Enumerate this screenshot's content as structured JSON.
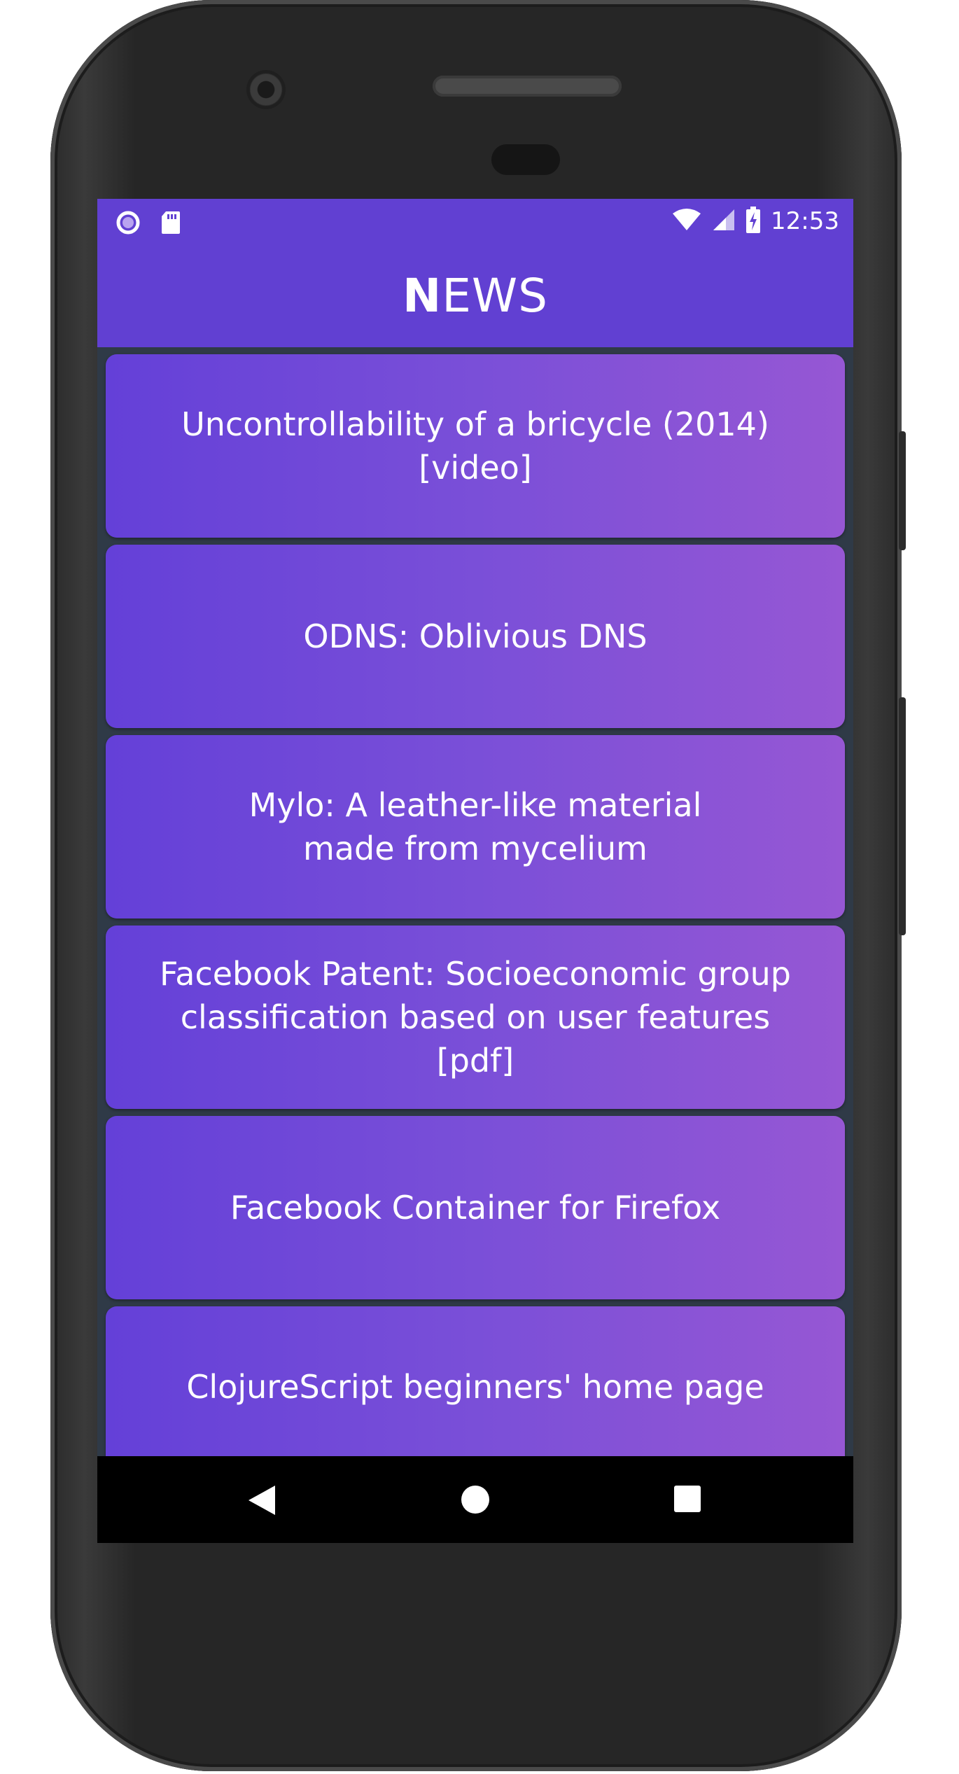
{
  "status_bar": {
    "time": "12:53",
    "left_icons": [
      "circle-notification-icon",
      "sd-card-icon"
    ],
    "right_icons": [
      "wifi-icon",
      "signal-icon",
      "battery-charging-icon"
    ]
  },
  "app_bar": {
    "title_first": "N",
    "title_rest": "EWS"
  },
  "news": {
    "items": [
      {
        "title": "Uncontrollability of a bricycle (2014) [video]"
      },
      {
        "title": "ODNS: Oblivious DNS"
      },
      {
        "title": "Mylo: A leather-like material made from mycelium"
      },
      {
        "title": "Facebook Patent: Socioeconomic group classification based on user features [pdf]"
      },
      {
        "title": "Facebook Container for Firefox"
      },
      {
        "title": "ClojureScript beginners' home page"
      }
    ]
  },
  "nav_bar": {
    "icons": [
      "back-icon",
      "home-icon",
      "recent-apps-icon"
    ]
  },
  "colors": {
    "app_bar": "#6140d2",
    "card_start": "#6440d8",
    "card_end": "#9657d4",
    "list_background": "#2f3a47"
  }
}
